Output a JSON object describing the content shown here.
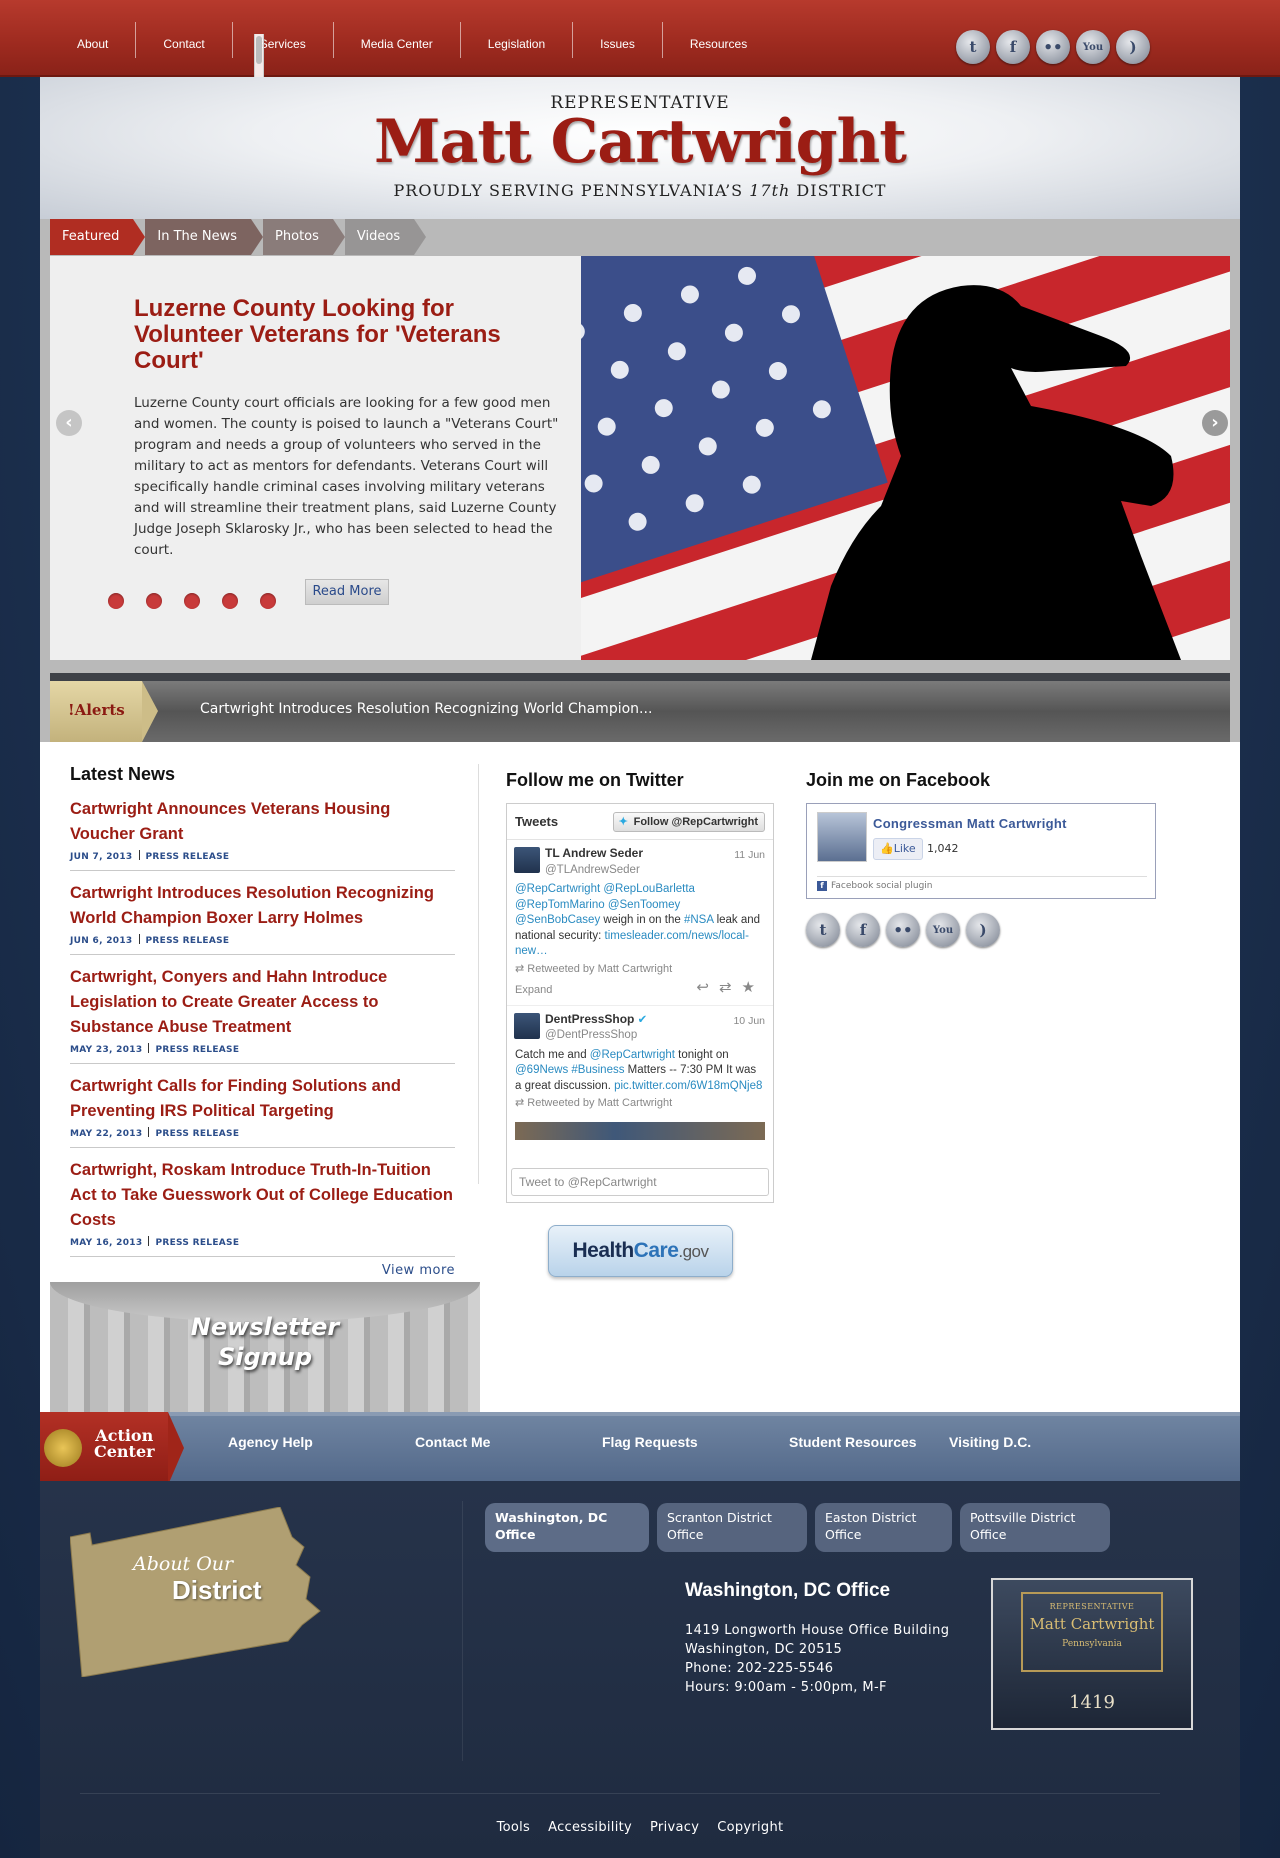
{
  "topnav": {
    "items": [
      "About",
      "Contact",
      "Services",
      "Media Center",
      "Legislation",
      "Issues",
      "Resources"
    ],
    "social": [
      "twitter-icon",
      "facebook-icon",
      "flickr-icon",
      "youtube-icon",
      "rss-icon"
    ]
  },
  "header": {
    "representative": "REPRESENTATIVE",
    "name": "Matt Cartwright",
    "serving_prefix": "PROUDLY SERVING PENNSYLVANIA’S ",
    "serving_district": "17th",
    "serving_suffix": " DISTRICT"
  },
  "slider": {
    "tabs": [
      "Featured",
      "In The News",
      "Photos",
      "Videos"
    ],
    "active_tab": "Featured",
    "title": "Luzerne County Looking for Volunteer Veterans for 'Veterans Court'",
    "text": "Luzerne County court officials are looking for a few good men and women. The county is poised to launch a \"Veterans Court\" program and needs a group of volunteers who served in the military to act as mentors for defendants. Veterans Court will specifically handle criminal cases involving military veterans and will streamline their treatment plans, said Luzerne County Judge Joseph Sklarosky Jr., who has been selected to head the court.",
    "read_more": "Read More",
    "slide_count": 5
  },
  "alerts": {
    "label": "!Alerts",
    "text": "Cartwright Introduces Resolution Recognizing World Champion..."
  },
  "latest_news": {
    "heading": "Latest News",
    "items": [
      {
        "title": "Cartwright Announces Veterans Housing Voucher Grant",
        "date": "JUN 7, 2013",
        "type": "PRESS RELEASE"
      },
      {
        "title": "Cartwright Introduces Resolution Recognizing World Champion Boxer Larry Holmes",
        "date": "JUN 6, 2013",
        "type": "PRESS RELEASE"
      },
      {
        "title": "Cartwright, Conyers and Hahn Introduce Legislation to Create Greater Access to Substance Abuse Treatment",
        "date": "MAY 23, 2013",
        "type": "PRESS RELEASE"
      },
      {
        "title": "Cartwright Calls for Finding Solutions and Preventing IRS Political Targeting",
        "date": "MAY 22, 2013",
        "type": "PRESS RELEASE"
      },
      {
        "title": "Cartwright, Roskam Introduce Truth-In-Tuition Act to Take Guesswork Out of College Education Costs",
        "date": "MAY 16, 2013",
        "type": "PRESS RELEASE"
      }
    ],
    "view_more": "View more"
  },
  "newsletter": {
    "line1": "Newsletter",
    "line2": "Signup"
  },
  "twitter": {
    "heading": "Follow me on Twitter",
    "box_title": "Tweets",
    "follow_label": "Follow @RepCartwright",
    "tweets": [
      {
        "name": "TL Andrew Seder",
        "handle": "@TLAndrewSeder",
        "date": "11 Jun",
        "links1": "@RepCartwright @RepLouBarletta @RepTomMarino @SenToomey @SenBobCasey",
        "text1": " weigh in on the ",
        "link2": "#NSA",
        "text2": " leak and national security: ",
        "link3": "timesleader.com/news/local-new…",
        "retweeted": "Retweeted by Matt Cartwright",
        "expand": "Expand"
      },
      {
        "name": "DentPressShop",
        "handle": "@DentPressShop",
        "date": "10 Jun",
        "text1": "Catch me and ",
        "link1": "@RepCartwright",
        "text2": " tonight on ",
        "link2": "@69News #Business",
        "text3": " Matters -- 7:30 PM It was a great discussion. ",
        "link3": "pic.twitter.com/6W18mQNje8",
        "retweeted": "Retweeted by Matt Cartwright"
      }
    ],
    "input_placeholder": "Tweet to @RepCartwright"
  },
  "healthcare": {
    "part1": "Health",
    "part2": "Care",
    "part3": ".gov"
  },
  "facebook": {
    "heading": "Join me on Facebook",
    "page_name": "Congressman Matt Cartwright",
    "like_label": "Like",
    "like_count": "1,042",
    "plugin_label": "Facebook social plugin"
  },
  "action_center": {
    "label_line1": "Action",
    "label_line2": "Center",
    "links": [
      "Agency Help",
      "Contact Me",
      "Flag Requests",
      "Student Resources",
      "Visiting D.C."
    ]
  },
  "district": {
    "about": "About Our",
    "district": "District"
  },
  "offices": {
    "tabs": [
      "Washington, DC Office",
      "Scranton District Office",
      "Easton District Office",
      "Pottsville District Office"
    ],
    "active": "Washington, DC Office",
    "title": "Washington, DC Office",
    "lines": [
      "1419 Longworth House Office Building",
      "Washington, DC 20515",
      "Phone: 202-225-5546",
      "Hours: 9:00am - 5:00pm, M-F"
    ],
    "plaque_top": "REPRESENTATIVE",
    "plaque_name": "Matt Cartwright",
    "plaque_state": "Pennsylvania",
    "room": "1419"
  },
  "footer_links": [
    "Tools",
    "Accessibility",
    "Privacy",
    "Copyright"
  ]
}
